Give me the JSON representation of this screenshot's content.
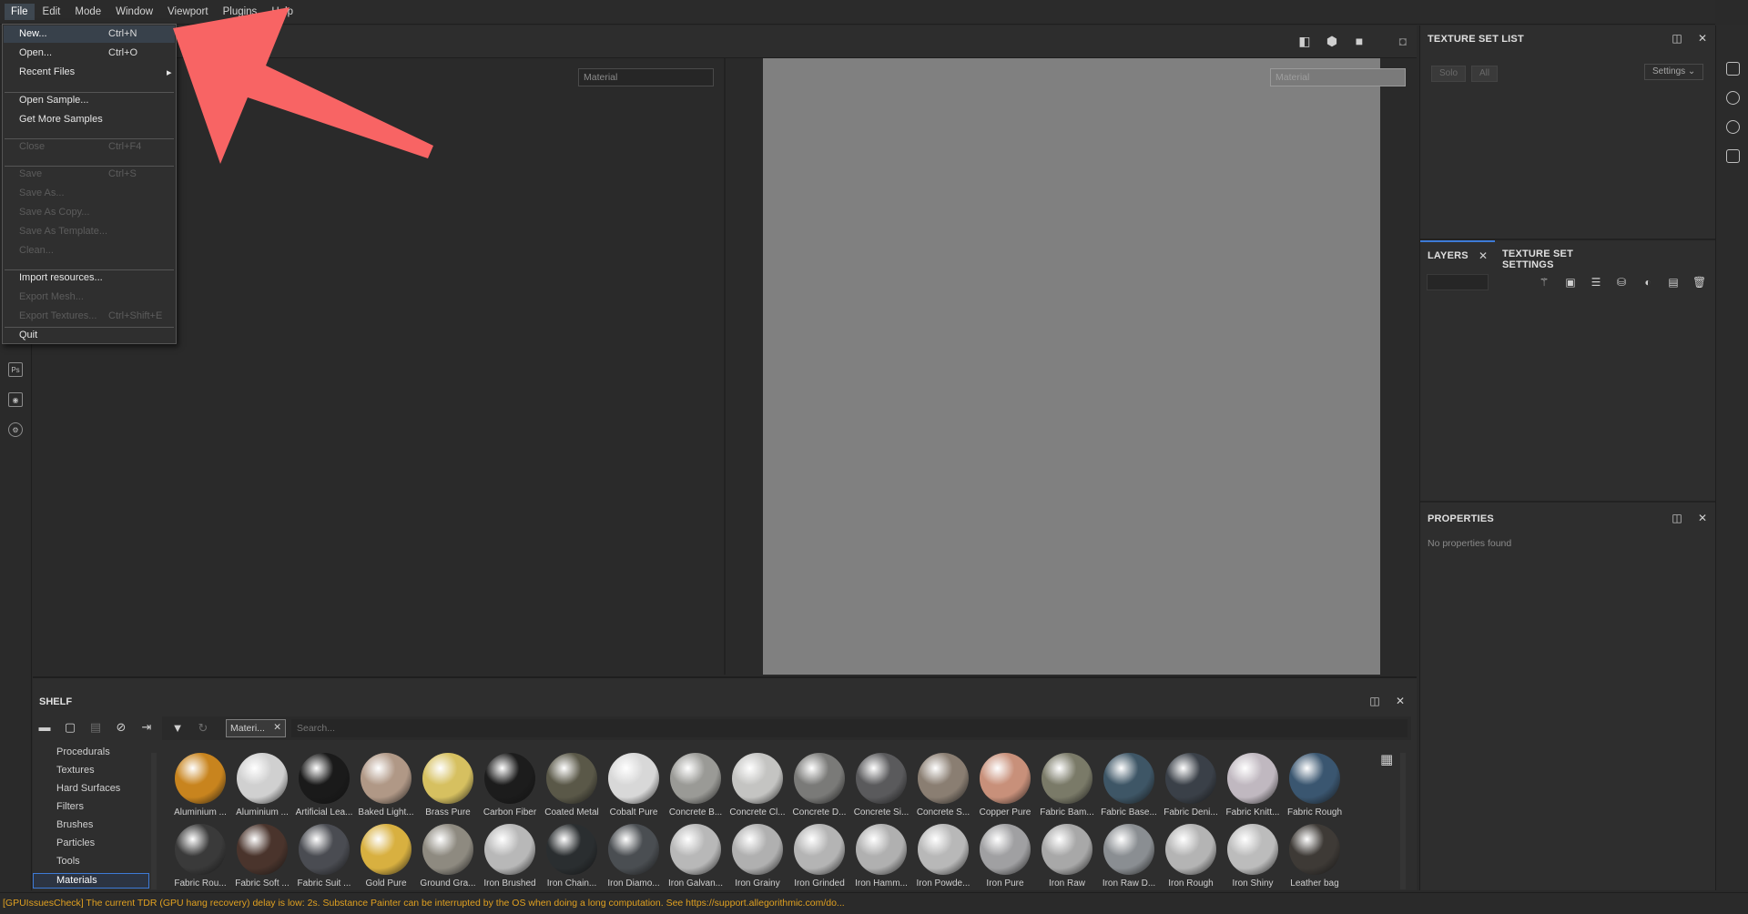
{
  "menubar": {
    "items": [
      "File",
      "Edit",
      "Mode",
      "Window",
      "Viewport",
      "Plugins",
      "Help"
    ]
  },
  "file_menu": {
    "items": [
      {
        "label": "New...",
        "shortcut": "Ctrl+N",
        "enabled": true,
        "highlighted": true
      },
      {
        "label": "Open...",
        "shortcut": "Ctrl+O",
        "enabled": true
      },
      {
        "label": "Recent Files",
        "shortcut": "",
        "enabled": true,
        "submenu": true
      },
      {
        "label": "Open Sample...",
        "shortcut": "",
        "enabled": true
      },
      {
        "label": "Get More Samples",
        "shortcut": "",
        "enabled": true
      },
      {
        "label": "Close",
        "shortcut": "Ctrl+F4",
        "enabled": false
      },
      {
        "label": "Save",
        "shortcut": "Ctrl+S",
        "enabled": false
      },
      {
        "label": "Save As...",
        "shortcut": "",
        "enabled": false
      },
      {
        "label": "Save As Copy...",
        "shortcut": "",
        "enabled": false
      },
      {
        "label": "Save As Template...",
        "shortcut": "",
        "enabled": false
      },
      {
        "label": "Clean...",
        "shortcut": "",
        "enabled": false
      },
      {
        "label": "Import resources...",
        "shortcut": "",
        "enabled": true
      },
      {
        "label": "Export Mesh...",
        "shortcut": "",
        "enabled": false
      },
      {
        "label": "Export Textures...",
        "shortcut": "Ctrl+Shift+E",
        "enabled": false
      },
      {
        "label": "Quit",
        "shortcut": "",
        "enabled": true
      }
    ],
    "submenu_arrow": "▸"
  },
  "viewport": {
    "left_channel": "Material",
    "right_channel": "Material"
  },
  "texture_set_list": {
    "title": "TEXTURE SET LIST",
    "solo_label": "Solo",
    "all_label": "All",
    "settings_label": "Settings"
  },
  "layers": {
    "tab_layers": "LAYERS",
    "tab_texture_settings": "TEXTURE SET SETTINGS"
  },
  "properties": {
    "title": "PROPERTIES",
    "empty_text": "No properties found"
  },
  "shelf": {
    "title": "SHELF",
    "filter_tag": "Materi...",
    "search_placeholder": "Search...",
    "categories": [
      "Procedurals",
      "Textures",
      "Hard Surfaces",
      "Filters",
      "Brushes",
      "Particles",
      "Tools",
      "Materials"
    ],
    "selected_category": "Materials",
    "materials": [
      {
        "name": "Aluminium ...",
        "color": "#c8841e"
      },
      {
        "name": "Aluminium ...",
        "color": "#d0d0d0"
      },
      {
        "name": "Artificial Lea...",
        "color": "#1a1a1a"
      },
      {
        "name": "Baked Light...",
        "color": "#b09886"
      },
      {
        "name": "Brass Pure",
        "color": "#d6c060"
      },
      {
        "name": "Carbon Fiber",
        "color": "#1c1c1c"
      },
      {
        "name": "Coated Metal",
        "color": "#5a5848"
      },
      {
        "name": "Cobalt Pure",
        "color": "#d8d8d8"
      },
      {
        "name": "Concrete B...",
        "color": "#9a9a96"
      },
      {
        "name": "Concrete Cl...",
        "color": "#c4c4c2"
      },
      {
        "name": "Concrete D...",
        "color": "#7a7a78"
      },
      {
        "name": "Concrete Si...",
        "color": "#5a5a5c"
      },
      {
        "name": "Concrete S...",
        "color": "#8a7e72"
      },
      {
        "name": "Copper Pure",
        "color": "#c8907a"
      },
      {
        "name": "Fabric Bam...",
        "color": "#7a7a68"
      },
      {
        "name": "Fabric Base...",
        "color": "#3e5666"
      },
      {
        "name": "Fabric Deni...",
        "color": "#3a4048"
      },
      {
        "name": "Fabric Knitt...",
        "color": "#c0b8c0"
      },
      {
        "name": "Fabric Rough",
        "color": "#3a5670"
      },
      {
        "name": "Fabric Rou...",
        "color": "#3a3a3a"
      },
      {
        "name": "Fabric Soft ...",
        "color": "#4a342c"
      },
      {
        "name": "Fabric Suit ...",
        "color": "#4a4c52"
      },
      {
        "name": "Gold Pure",
        "color": "#d8b040"
      },
      {
        "name": "Ground Gra...",
        "color": "#8e8a80"
      },
      {
        "name": "Iron Brushed",
        "color": "#b8b8b8"
      },
      {
        "name": "Iron Chain...",
        "color": "#2a2e30"
      },
      {
        "name": "Iron Diamo...",
        "color": "#4a4e52"
      },
      {
        "name": "Iron Galvan...",
        "color": "#b8b8b8"
      },
      {
        "name": "Iron Grainy",
        "color": "#b0b0b0"
      },
      {
        "name": "Iron Grinded",
        "color": "#b4b4b4"
      },
      {
        "name": "Iron Hamm...",
        "color": "#b0b0b0"
      },
      {
        "name": "Iron Powde...",
        "color": "#b8b8b8"
      },
      {
        "name": "Iron Pure",
        "color": "#a0a0a2"
      },
      {
        "name": "Iron Raw",
        "color": "#a8a8a8"
      },
      {
        "name": "Iron Raw D...",
        "color": "#8a8e92"
      },
      {
        "name": "Iron Rough",
        "color": "#b4b4b4"
      },
      {
        "name": "Iron Shiny",
        "color": "#bcbcbc"
      },
      {
        "name": "Leather bag",
        "color": "#3e3a36"
      }
    ]
  },
  "statusbar": {
    "message": "[GPUIssuesCheck] The current TDR (GPU hang recovery) delay is low: 2s. Substance Painter can be interrupted by the OS when doing a long computation. See https://support.allegorithmic.com/do..."
  },
  "annotation": {
    "arrow_color": "#f86464"
  }
}
